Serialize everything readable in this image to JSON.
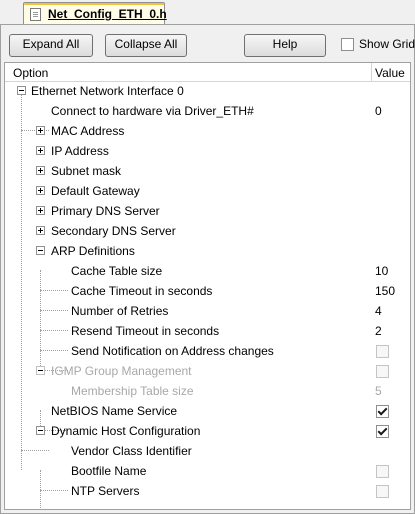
{
  "tab": {
    "title": "Net_Config_ETH_0.h"
  },
  "toolbar": {
    "expand_all": "Expand All",
    "collapse_all": "Collapse All",
    "help": "Help",
    "show_grid": "Show Grid"
  },
  "grid": {
    "col_option": "Option",
    "col_value": "Value",
    "rows": [
      {
        "label": "Ethernet Network Interface 0",
        "value": ""
      },
      {
        "label": "Connect to hardware via Driver_ETH#",
        "value": "0"
      },
      {
        "label": "MAC Address",
        "value": ""
      },
      {
        "label": "IP Address",
        "value": ""
      },
      {
        "label": "Subnet mask",
        "value": ""
      },
      {
        "label": "Default Gateway",
        "value": ""
      },
      {
        "label": "Primary DNS Server",
        "value": ""
      },
      {
        "label": "Secondary DNS Server",
        "value": ""
      },
      {
        "label": "ARP Definitions",
        "value": ""
      },
      {
        "label": "Cache Table size",
        "value": "10"
      },
      {
        "label": "Cache Timeout in seconds",
        "value": "150"
      },
      {
        "label": "Number of Retries",
        "value": "4"
      },
      {
        "label": "Resend Timeout in seconds",
        "value": "2"
      },
      {
        "label": "Send Notification on Address changes",
        "value": "",
        "checked": false
      },
      {
        "label": "IGMP Group Management",
        "value": "",
        "checked": false
      },
      {
        "label": "Membership Table size",
        "value": "5"
      },
      {
        "label": "NetBIOS Name Service",
        "value": "",
        "checked": true
      },
      {
        "label": "Dynamic Host Configuration",
        "value": "",
        "checked": true
      },
      {
        "label": "Vendor Class Identifier",
        "value": ""
      },
      {
        "label": "Bootfile Name",
        "value": "",
        "checked": false
      },
      {
        "label": "NTP Servers",
        "value": "",
        "checked": false
      }
    ]
  }
}
